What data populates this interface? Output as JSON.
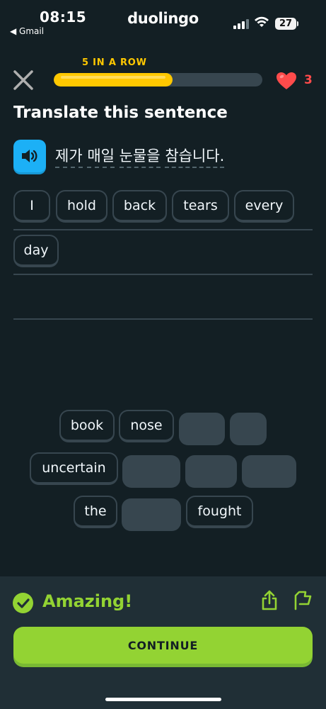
{
  "status_bar": {
    "time": "08:15",
    "back_app": "◀ Gmail",
    "carrier_logo": "duolingo",
    "battery": "27"
  },
  "lesson": {
    "streak_label": "5 IN A ROW",
    "progress_fraction": 0.57,
    "hearts": "3"
  },
  "prompt": {
    "title": "Translate this sentence",
    "sentence_words": [
      "제가",
      "매일",
      "눈물을",
      "참습니다."
    ]
  },
  "answer": {
    "words": [
      "I",
      "hold",
      "back",
      "tears",
      "every",
      "day"
    ]
  },
  "word_bank": {
    "row1": [
      "book",
      "nose",
      "",
      ""
    ],
    "row2": [
      "uncertain",
      "",
      "",
      ""
    ],
    "row3": [
      "the",
      "",
      "fought"
    ]
  },
  "feedback": {
    "message": "Amazing!",
    "continue_label": "CONTINUE"
  },
  "colors": {
    "background": "#131f24",
    "accent_green": "#93d333",
    "streak_yellow": "#ffc800",
    "heart_red": "#ff4b4b",
    "speaker_blue": "#1cb0f6"
  },
  "icons": [
    "close-icon",
    "heart-icon",
    "speaker-icon",
    "check-icon",
    "share-icon",
    "flag-icon"
  ]
}
